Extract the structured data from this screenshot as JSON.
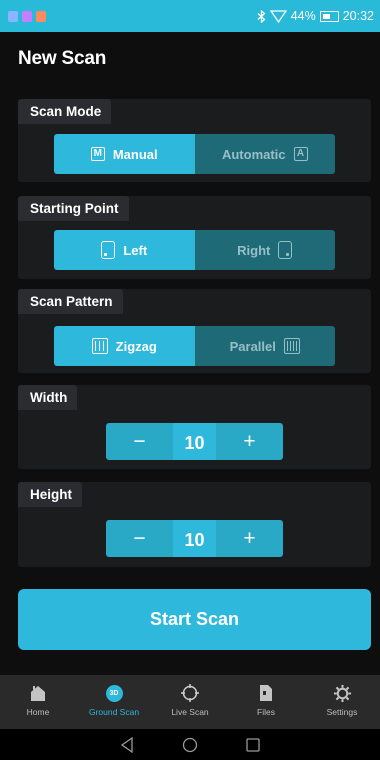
{
  "status_bar": {
    "app_icon_colors": [
      "#8ab6ff",
      "#c77dff",
      "#ff8a5c"
    ],
    "battery_text": "44%",
    "time": "20:32",
    "icons": [
      "bluetooth-icon",
      "signal-icon",
      "battery-icon"
    ]
  },
  "page": {
    "title": "New Scan"
  },
  "scan_mode": {
    "label": "Scan Mode",
    "options": [
      {
        "label": "Manual",
        "icon_glyph": "M",
        "selected": true
      },
      {
        "label": "Automatic",
        "icon_glyph": "A",
        "selected": false
      }
    ]
  },
  "starting_point": {
    "label": "Starting Point",
    "options": [
      {
        "label": "Left",
        "selected": true
      },
      {
        "label": "Right",
        "selected": false
      }
    ]
  },
  "scan_pattern": {
    "label": "Scan Pattern",
    "options": [
      {
        "label": "Zigzag",
        "selected": true
      },
      {
        "label": "Parallel",
        "selected": false
      }
    ]
  },
  "width": {
    "label": "Width",
    "value": "10",
    "minus": "−",
    "plus": "+"
  },
  "height": {
    "label": "Height",
    "value": "10",
    "minus": "−",
    "plus": "+"
  },
  "start_button": {
    "label": "Start Scan"
  },
  "tab_bar": {
    "items": [
      {
        "label": "Home",
        "icon": "home-icon",
        "active": false
      },
      {
        "label": "Ground Scan",
        "icon": "3d-icon",
        "icon_text": "3D",
        "active": true
      },
      {
        "label": "Live Scan",
        "icon": "crosshair-icon",
        "active": false
      },
      {
        "label": "Files",
        "icon": "file-icon",
        "active": false
      },
      {
        "label": "Settings",
        "icon": "gear-icon",
        "active": false
      }
    ]
  },
  "nav_bar": {
    "icons": [
      "back-icon",
      "home-circle-icon",
      "recents-icon"
    ]
  },
  "colors": {
    "accent": "#2db8dc",
    "accent_dark": "#1f6a77",
    "background": "#0e0e0e",
    "panel": "#1b1c1e",
    "tab_bar": "#2a2a2a"
  }
}
